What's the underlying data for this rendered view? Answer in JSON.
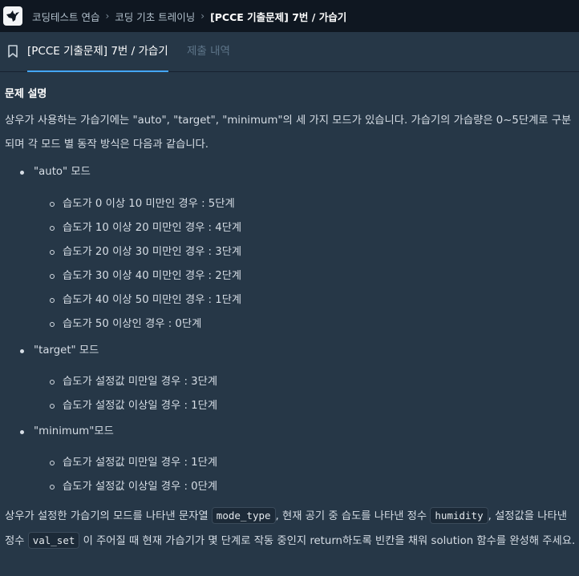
{
  "topnav": {
    "breadcrumbs": [
      "코딩테스트 연습",
      "코딩 기초 트레이닝",
      "[PCCE 기출문제] 7번 / 가습기"
    ]
  },
  "tabs": {
    "active": "[PCCE 기출문제] 7번 / 가습기",
    "submissions": "제출 내역"
  },
  "problem": {
    "section_title": "문제 설명",
    "intro": "상우가 사용하는 가습기에는 \"auto\", \"target\", \"minimum\"의 세 가지 모드가 있습니다. 가습기의 가습량은 0~5단계로 구분되며 각 모드 별 동작 방식은 다음과 같습니다.",
    "modes": [
      {
        "name": "\"auto\" 모드",
        "rules": [
          "습도가 0 이상 10 미만인 경우 : 5단계",
          "습도가 10 이상 20 미만인 경우 : 4단계",
          "습도가 20 이상 30 미만인 경우 : 3단계",
          "습도가 30 이상 40 미만인 경우 : 2단계",
          "습도가 40 이상 50 미만인 경우 : 1단계",
          "습도가 50 이상인 경우 : 0단계"
        ]
      },
      {
        "name": "\"target\" 모드",
        "rules": [
          "습도가 설정값 미만일 경우 : 3단계",
          "습도가 설정값 이상일 경우 : 1단계"
        ]
      },
      {
        "name": "\"minimum\"모드",
        "rules": [
          "습도가 설정값 미만일 경우 : 1단계",
          "습도가 설정값 이상일 경우 : 0단계"
        ]
      }
    ],
    "outro": {
      "t1": "상우가 설정한 가습기의 모드를 나타낸 문자열 ",
      "code1": "mode_type",
      "t2": ", 현재 공기 중 습도를 나타낸 정수 ",
      "code2": "humidity",
      "t3": ", 설정값을 나타낸 정수 ",
      "code3": "val_set",
      "t4": " 이 주어질 때 현재 가습기가 몇 단계로 작동 중인지 return하도록 빈칸을 채워 solution 함수를 완성해 주세요."
    }
  },
  "icons": {
    "logo": "bird-logo-icon",
    "bookmark": "bookmark-icon",
    "breadcrumb_separator": "chevron-right-icon"
  },
  "colors": {
    "background": "#263747",
    "topnav": "#0f1721",
    "active_tab_underline": "#44a6ff"
  }
}
